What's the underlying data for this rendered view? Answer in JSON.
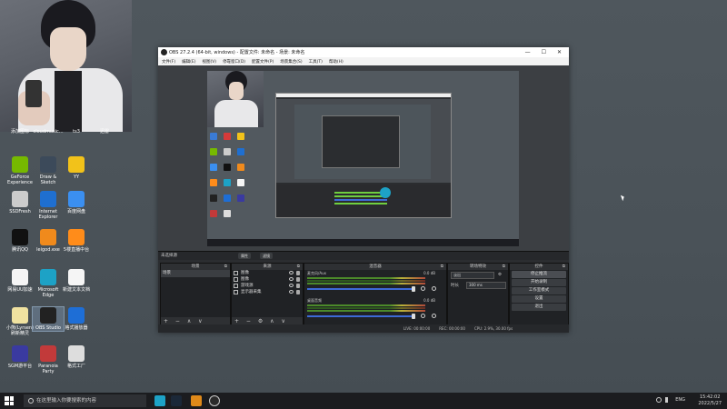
{
  "desktop": {
    "icons": [
      {
        "label": "添加图标",
        "icon": "app-icon",
        "color": "#3a7bd5"
      },
      {
        "label": "cloudmusic...",
        "icon": "music-icon",
        "color": "#d63a3a"
      },
      {
        "label": "ts3",
        "icon": "ts3-icon",
        "color": "#4a90c2"
      },
      {
        "label": "迅雷",
        "icon": "thunder-icon",
        "color": "#2a72d4"
      },
      {
        "label": "GeForce Experience",
        "icon": "geforce-icon",
        "color": "#76b900"
      },
      {
        "label": "Draw & Sketch",
        "icon": "draw-icon",
        "color": "#3c4a5a"
      },
      {
        "label": "YY",
        "icon": "yy-icon",
        "color": "#f2c21a"
      },
      {
        "label": "SSDFresh",
        "icon": "ssd-icon",
        "color": "#cccccc"
      },
      {
        "label": "Internet Explorer",
        "icon": "ie-icon",
        "color": "#1f6fd0"
      },
      {
        "label": "百度网盘",
        "icon": "baidu-disk-icon",
        "color": "#3b8ff0"
      },
      {
        "label": "腾讯QQ",
        "icon": "qq-icon",
        "color": "#111111"
      },
      {
        "label": "leigod.exe",
        "icon": "leigod-icon",
        "color": "#f08a1c"
      },
      {
        "label": "5楼直播中台",
        "icon": "live-icon",
        "color": "#ff8c1a"
      },
      {
        "label": "网易UU加速",
        "icon": "uu-icon",
        "color": "#f5f5f5"
      },
      {
        "label": "Microsoft Edge",
        "icon": "edge-icon",
        "color": "#1da2c6"
      },
      {
        "label": "新建文本文档",
        "icon": "document-icon",
        "color": "#f5f5f5"
      },
      {
        "label": "小熊(Lyrsen)刷新精灵",
        "icon": "folder-icon",
        "color": "#f0e2a0"
      },
      {
        "label": "OBS Studio",
        "icon": "obs-icon",
        "color": "#222222"
      },
      {
        "label": "格式播放器",
        "icon": "player-icon",
        "color": "#1e6ed6"
      },
      {
        "label": "SGM游平台",
        "icon": "sgm-icon",
        "color": "#3a3aa0"
      },
      {
        "label": "Paranoia Party",
        "icon": "party-icon",
        "color": "#c23a3a"
      },
      {
        "label": "格式工厂",
        "icon": "factory-icon",
        "color": "#dddddd"
      }
    ]
  },
  "obs": {
    "title": "OBS 27.2.4 (64-bit, windows) - 配置文件: 未命名 - 场景: 未命名",
    "window_controls": [
      "—",
      "☐",
      "✕"
    ],
    "menu": [
      "文件(F)",
      "编辑(E)",
      "视图(V)",
      "停靠窗口(D)",
      "配置文件(P)",
      "场景集合(S)",
      "工具(T)",
      "帮助(H)"
    ],
    "docks_bar": {
      "title": "未选择源",
      "props_button": "属性",
      "filter_button": "滤镜"
    },
    "scenes": {
      "header": "场景",
      "items": [
        "场景"
      ],
      "footer": "+ − ∧ ∨"
    },
    "sources": {
      "header": "来源",
      "items": [
        "图像",
        "图像",
        "游戏源",
        "显示器采集"
      ],
      "footer": "+ − ⚙ ∧ ∨"
    },
    "mixer": {
      "header": "混音器",
      "channels": [
        {
          "name": "麦克风/Aux",
          "db": "0.0 dB"
        },
        {
          "name": "桌面音频",
          "db": "0.0 dB"
        }
      ]
    },
    "transitions": {
      "header": "转场特效",
      "type": "淡出",
      "duration_label": "时长",
      "duration": "300 ms"
    },
    "controls": {
      "header": "控件",
      "buttons": [
        "停止推流",
        "开始录制",
        "工作室模式",
        "设置",
        "退出"
      ]
    },
    "status": [
      "LIVE: 00:00:00",
      "REC: 00:00:00",
      "CPU: 2.9%, 30.00 fps"
    ]
  },
  "taskbar": {
    "search_placeholder": "在这里输入你要搜索的内容",
    "apps": [
      {
        "icon": "edge-taskbar-icon",
        "color": "#1da2c6"
      },
      {
        "icon": "steam-taskbar-icon",
        "color": "#1b2838"
      },
      {
        "icon": "app-taskbar-icon",
        "color": "#e08a1a"
      },
      {
        "icon": "obs-taskbar-icon",
        "color": "#2a2a2a"
      }
    ],
    "lang": "ENG",
    "time": "15:42:02",
    "date": "2022/5/27"
  }
}
